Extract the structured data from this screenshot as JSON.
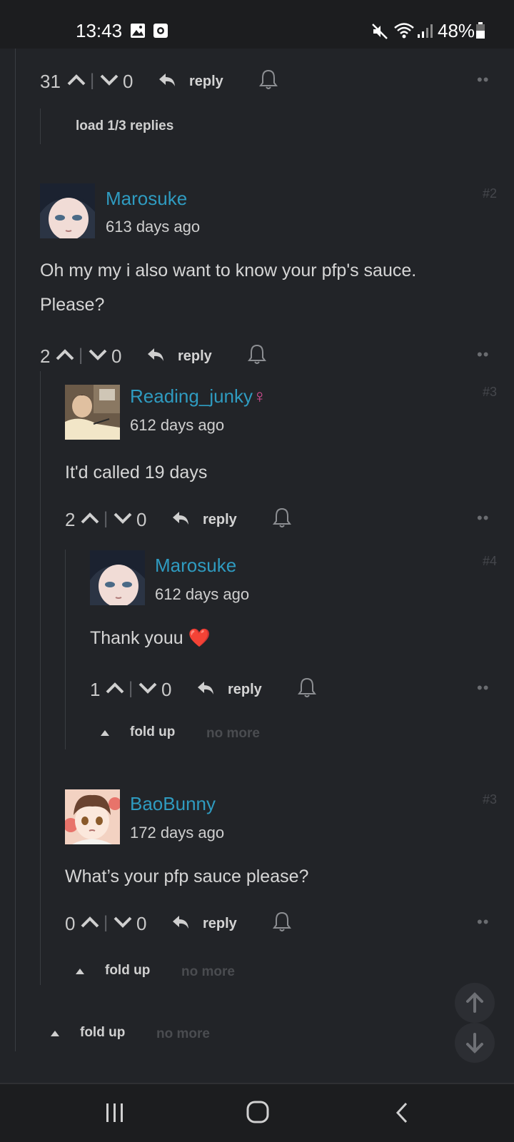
{
  "status_bar": {
    "time": "13:43",
    "battery": "48%"
  },
  "top_actions": {
    "up": "31",
    "down": "0",
    "reply": "reply"
  },
  "load_replies": "load 1/3 replies",
  "comments": [
    {
      "name": "Marosuke",
      "date": "613 days ago",
      "num": "#2",
      "body": [
        "Oh my my i also want to know your pfp's sauce.",
        "Please?"
      ],
      "up": "2",
      "down": "0",
      "reply": "reply"
    },
    {
      "name": "Reading_junky",
      "gender": "♀",
      "date": "612 days ago",
      "num": "#3",
      "body": [
        "It'd called 19 days"
      ],
      "up": "2",
      "down": "0",
      "reply": "reply"
    },
    {
      "name": "Marosuke",
      "date": "612 days ago",
      "num": "#4",
      "body": [
        "Thank youu ❤️"
      ],
      "up": "1",
      "down": "0",
      "reply": "reply"
    },
    {
      "name": "BaoBunny",
      "date": "172 days ago",
      "num": "#3",
      "body": [
        "What’s your pfp sauce please?"
      ],
      "up": "0",
      "down": "0",
      "reply": "reply"
    }
  ],
  "fold": {
    "label": "fold up",
    "no_more": "no more"
  },
  "colors": {
    "background": "#222428",
    "username": "#2f9bc0",
    "gender": "#e0509a",
    "heart": "#e0202c"
  },
  "icons": [
    "image-icon",
    "screenshot-icon",
    "mute-icon",
    "wifi-icon",
    "signal-icon",
    "battery-icon",
    "upvote-icon",
    "downvote-icon",
    "reply-icon",
    "bell-icon",
    "more-icon",
    "arrow-up-icon",
    "arrow-down-icon",
    "recents-icon",
    "home-icon",
    "back-icon"
  ]
}
